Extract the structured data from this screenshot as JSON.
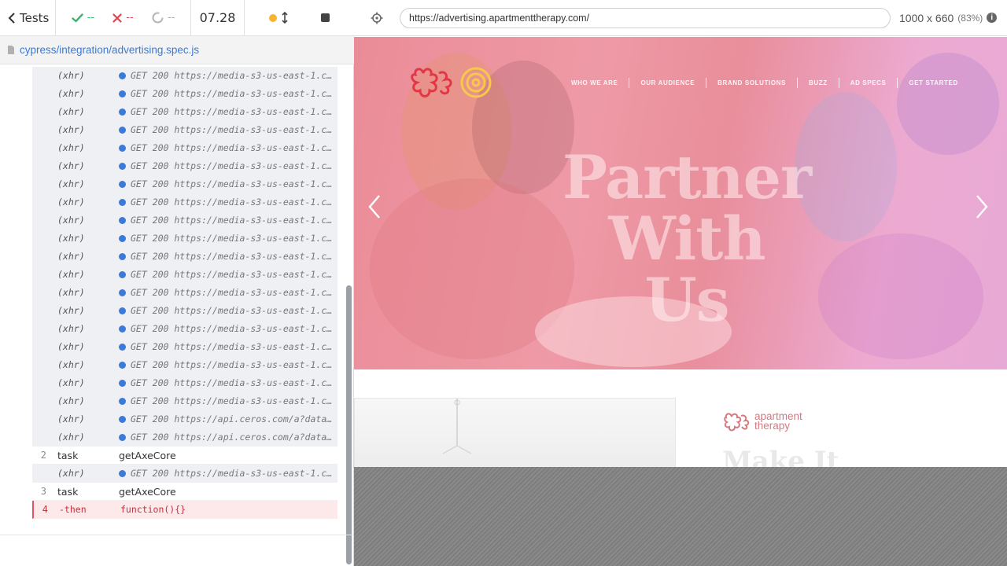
{
  "reporter": {
    "tests_label": "Tests",
    "passed": "--",
    "failed": "--",
    "pending": "--",
    "duration": "07.28",
    "spec_path": "cypress/integration/advertising.spec.js",
    "commands": [
      {
        "num": "",
        "name": "(xhr)",
        "msg": "GET 200 https://media-s3-us-east-1.ceros.com/...",
        "kind": "xhr"
      },
      {
        "num": "",
        "name": "(xhr)",
        "msg": "GET 200 https://media-s3-us-east-1.ceros.com/...",
        "kind": "xhr"
      },
      {
        "num": "",
        "name": "(xhr)",
        "msg": "GET 200 https://media-s3-us-east-1.ceros.com/...",
        "kind": "xhr"
      },
      {
        "num": "",
        "name": "(xhr)",
        "msg": "GET 200 https://media-s3-us-east-1.ceros.com/...",
        "kind": "xhr"
      },
      {
        "num": "",
        "name": "(xhr)",
        "msg": "GET 200 https://media-s3-us-east-1.ceros.com/...",
        "kind": "xhr"
      },
      {
        "num": "",
        "name": "(xhr)",
        "msg": "GET 200 https://media-s3-us-east-1.ceros.com/...",
        "kind": "xhr"
      },
      {
        "num": "",
        "name": "(xhr)",
        "msg": "GET 200 https://media-s3-us-east-1.ceros.com/...",
        "kind": "xhr"
      },
      {
        "num": "",
        "name": "(xhr)",
        "msg": "GET 200 https://media-s3-us-east-1.ceros.com/...",
        "kind": "xhr"
      },
      {
        "num": "",
        "name": "(xhr)",
        "msg": "GET 200 https://media-s3-us-east-1.ceros.com/...",
        "kind": "xhr"
      },
      {
        "num": "",
        "name": "(xhr)",
        "msg": "GET 200 https://media-s3-us-east-1.ceros.com/...",
        "kind": "xhr"
      },
      {
        "num": "",
        "name": "(xhr)",
        "msg": "GET 200 https://media-s3-us-east-1.ceros.com/...",
        "kind": "xhr"
      },
      {
        "num": "",
        "name": "(xhr)",
        "msg": "GET 200 https://media-s3-us-east-1.ceros.com/...",
        "kind": "xhr"
      },
      {
        "num": "",
        "name": "(xhr)",
        "msg": "GET 200 https://media-s3-us-east-1.ceros.com/...",
        "kind": "xhr"
      },
      {
        "num": "",
        "name": "(xhr)",
        "msg": "GET 200 https://media-s3-us-east-1.ceros.com/...",
        "kind": "xhr"
      },
      {
        "num": "",
        "name": "(xhr)",
        "msg": "GET 200 https://media-s3-us-east-1.ceros.com/...",
        "kind": "xhr"
      },
      {
        "num": "",
        "name": "(xhr)",
        "msg": "GET 200 https://media-s3-us-east-1.ceros.com/...",
        "kind": "xhr"
      },
      {
        "num": "",
        "name": "(xhr)",
        "msg": "GET 200 https://media-s3-us-east-1.ceros.com/...",
        "kind": "xhr"
      },
      {
        "num": "",
        "name": "(xhr)",
        "msg": "GET 200 https://media-s3-us-east-1.ceros.com/...",
        "kind": "xhr"
      },
      {
        "num": "",
        "name": "(xhr)",
        "msg": "GET 200 https://media-s3-us-east-1.ceros.com/...",
        "kind": "xhr"
      },
      {
        "num": "",
        "name": "(xhr)",
        "msg": "GET 200 https://api.ceros.com/a?data=eyJ...",
        "kind": "xhr"
      },
      {
        "num": "",
        "name": "(xhr)",
        "msg": "GET 200 https://api.ceros.com/a?data=eyJ...",
        "kind": "xhr"
      },
      {
        "num": "2",
        "name": "task",
        "msg": "getAxeCore",
        "kind": "task"
      },
      {
        "num": "",
        "name": "(xhr)",
        "msg": "GET 200 https://media-s3-us-east-1.ceros.com/...",
        "kind": "xhr"
      },
      {
        "num": "3",
        "name": "task",
        "msg": "getAxeCore",
        "kind": "task"
      },
      {
        "num": "4",
        "name": "-then",
        "msg": "function(){}",
        "kind": "fail"
      }
    ]
  },
  "aut": {
    "url": "https://advertising.apartmenttherapy.com/",
    "viewport": "1000 x 660",
    "scale": "(83%)",
    "nav": [
      "WHO WE ARE",
      "OUR AUDIENCE",
      "BRAND SOLUTIONS",
      "BUZZ",
      "AD SPECS",
      "GET STARTED"
    ],
    "hero_line1": "Partner",
    "hero_line2": "With Us",
    "brand_line1": "apartment",
    "brand_line2": "therapy",
    "section_heading": "Make It"
  },
  "colors": {
    "pass": "#3cb371",
    "fail": "#e0434f",
    "link": "#3b7ad8",
    "hero_pink": "#ea8c98",
    "logo_red": "#e23744",
    "logo_yellow": "#f6c94a"
  }
}
